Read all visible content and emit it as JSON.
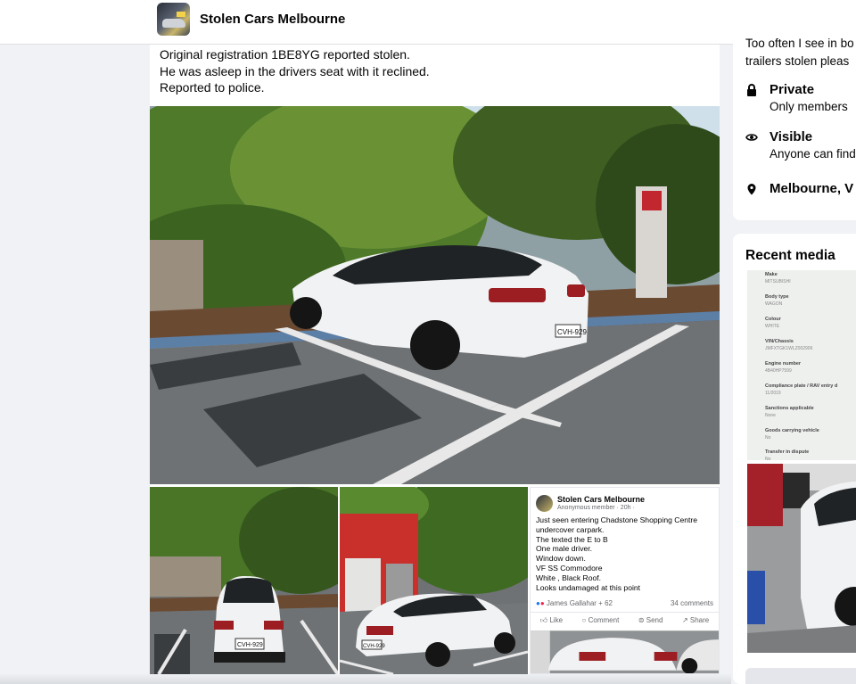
{
  "header": {
    "group_name": "Stolen Cars Melbourne",
    "avatar_icon": "group-avatar-icon"
  },
  "post": {
    "lines": [
      "Original registration 1BE8YG reported stolen.",
      "He was asleep in the drivers seat with it reclined.",
      "Reported to police."
    ],
    "main_photo_plate": "CVH-929",
    "photo_a_plate": "CVH-929",
    "photo_b_plate": "CVH-929"
  },
  "shared_screenshot": {
    "group_name": "Stolen Cars Melbourne",
    "meta": "Anonymous member · 20h ·",
    "body": [
      "Just seen entering Chadstone Shopping Centre",
      "undercover carpark.",
      "The texted the E to B",
      "One male driver.",
      "Window down.",
      "VF SS Commodore",
      "White , Black Roof.",
      "Looks undamaged at this point"
    ],
    "reactions": "James Gallahar + 62",
    "comments": "34 comments",
    "actions": {
      "like": "Like",
      "comment": "Comment",
      "send": "Send",
      "share": "Share"
    }
  },
  "about": {
    "partial_line_1": "Too often I see in bo",
    "partial_line_2": "trailers stolen pleas",
    "private_title": "Private",
    "private_sub": "Only members",
    "visible_title": "Visible",
    "visible_sub": "Anyone can find",
    "location": "Melbourne, V"
  },
  "recent_media": {
    "title": "Recent media",
    "doc_fields": [
      {
        "label": "Make",
        "value": "MITSUBISHI"
      },
      {
        "label": "Body type",
        "value": "WAGON"
      },
      {
        "label": "Colour",
        "value": "WHITE"
      },
      {
        "label": "VIN/Chassis",
        "value": "JMFXTGK1WLZ002906"
      },
      {
        "label": "Engine number",
        "value": "4B40HP7599"
      },
      {
        "label": "Compliance plate / RAV entry d",
        "value": "11/2019"
      },
      {
        "label": "Sanctions applicable",
        "value": "None"
      },
      {
        "label": "Goods carrying vehicle",
        "value": "No"
      },
      {
        "label": "Transfer in dispute",
        "value": "No"
      }
    ]
  },
  "colors": {
    "page_bg": "#f0f2f5",
    "card_bg": "#ffffff",
    "text": "#050505",
    "muted": "#65676b",
    "accent": "#1877f2"
  }
}
